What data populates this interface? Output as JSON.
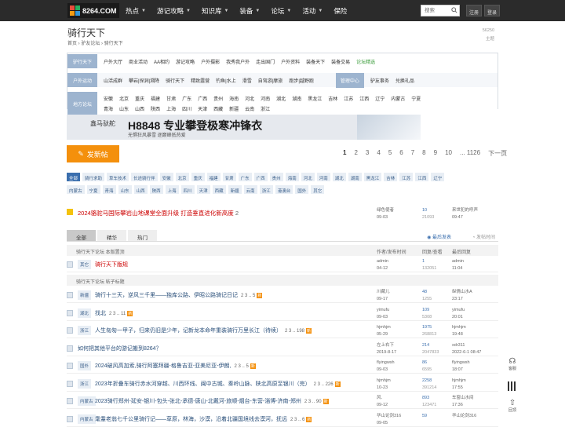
{
  "site": {
    "logo_text": "8264.COM",
    "nav": [
      {
        "label": "热点",
        "dropdown": true
      },
      {
        "label": "游记攻略",
        "dropdown": true
      },
      {
        "label": "知识库",
        "dropdown": true
      },
      {
        "label": "装备",
        "dropdown": true
      },
      {
        "label": "论坛",
        "dropdown": true
      },
      {
        "label": "活动",
        "dropdown": true
      },
      {
        "label": "保险",
        "dropdown": false
      }
    ],
    "search_placeholder": "搜索",
    "register": "注册",
    "login": "登录"
  },
  "forum": {
    "title": "骑行天下",
    "breadcrumb": "首页 › 驴友论坛 › 骑行天下",
    "stat_num": "56250",
    "stat_label": "主题"
  },
  "categories": [
    {
      "label": "驴行天下",
      "items": [
        "户外大厅",
        "商业活动",
        "AA相约",
        "游记攻略",
        "户外摄影",
        "我秀我户外",
        "走出国门",
        "户外资料",
        "装备天下",
        "装备交易",
        "论坛精选"
      ]
    },
    {
      "label": "户外运动",
      "items": [
        "山活成群",
        "攀岩|探洞|溯降",
        "骑行天下",
        "精致露营",
        "钓鱼|水上",
        "滑雪",
        "自驾游|摩旅",
        "跑步|越野跑"
      ],
      "extra": [
        "驴友事务",
        "兑换礼品"
      ],
      "selected": "管理中心"
    },
    {
      "label": "地方论坛",
      "items": [
        "安徽",
        "北京",
        "重庆",
        "福建",
        "甘肃",
        "广东",
        "广西",
        "贵州",
        "海南",
        "河北",
        "河南",
        "湖北",
        "湖南",
        "黑龙江",
        "吉林",
        "江苏",
        "江西",
        "辽宁",
        "内蒙古",
        "宁夏"
      ],
      "items2": [
        "青海",
        "山东",
        "山西",
        "陕西",
        "上海",
        "四川",
        "天津",
        "西藏",
        "新疆",
        "云南",
        "浙江"
      ]
    }
  ],
  "banner": {
    "brand": "鑫马驮舵",
    "title": "H8848 专业攀登极寒冲锋衣",
    "sub": "无惧狂风暴雪  逐巅峰抵热爱"
  },
  "post_button": "发新帖",
  "pager": [
    "1",
    "2",
    "3",
    "4",
    "5",
    "6",
    "7",
    "8",
    "9",
    "10",
    "... 1126",
    "下一页"
  ],
  "tags_row1": [
    "全部",
    "骑行求助",
    "草车技术",
    "长途骑行伴",
    "安徽",
    "北京",
    "重庆",
    "福建",
    "甘肃",
    "广东",
    "广西",
    "贵州",
    "海南",
    "河北",
    "河南",
    "湖北",
    "湖南",
    "黑龙江",
    "吉林",
    "江苏",
    "江西",
    "辽宁"
  ],
  "tags_row2": [
    "内蒙古",
    "宁夏",
    "青海",
    "山东",
    "山西",
    "陕西",
    "上海",
    "四川",
    "天津",
    "西藏",
    "新疆",
    "云南",
    "浙江",
    "港澳台",
    "国外",
    "其它"
  ],
  "announcement": {
    "title": "2024骆驼马国际攀岩山地课堂全面升级 打造垂直进化新高度",
    "count": "2",
    "author": "绿色使者",
    "date": "09-03",
    "replies": "10",
    "views": "21093",
    "last": "来世犯的呼声",
    "last_time": "09:47"
  },
  "tabs": [
    "全部",
    "精华",
    "热门"
  ],
  "sort_new": "最后发表",
  "sort_time": "发帖时间",
  "header": {
    "col1": "骑行天下论坛 本版置顶",
    "col2": "作者/发布时间",
    "col3": "回复/查看",
    "col4": "最后回复"
  },
  "pinned": [
    {
      "tag": "其它",
      "title": "骑行天下版规",
      "author": "admin",
      "date": "04-12",
      "replies": "1",
      "views": "132051",
      "last": "admin",
      "last_time": "11:04"
    }
  ],
  "section2": "骑行天下论坛 帖子标题",
  "rows": [
    {
      "tag": "新疆",
      "title": "骑行十三天，逆风三千里——独库公路、伊昭公路骑记日记",
      "pages": "2 3 .. 5",
      "new": true,
      "author": "川藏儿",
      "date": "09-17",
      "replies": "48",
      "views": "1255",
      "last": "纵情山水A",
      "last_time": "23:17"
    },
    {
      "tag": "湖北",
      "title": "找北",
      "pages": "2 3 .. 11",
      "new": true,
      "author": "yimufu",
      "date": "09-03",
      "replies": "109",
      "views": "5308",
      "last": "yimufu",
      "last_time": "20:01"
    },
    {
      "tag": "浙江",
      "title": "人生匆匆一甲子，归来仍旧是少年，记新龙本命年重装骑行万里长江（待续）",
      "pages": "2 3 .. 198",
      "new": true,
      "author": "hjmhjm",
      "date": "05-29",
      "replies": "1975",
      "views": "268813",
      "last": "hjmhjm",
      "last_time": "19:48"
    },
    {
      "tag": "",
      "title": "如何把其他平台的游记搬到8264？",
      "pages": "",
      "new": false,
      "author": "左上右下",
      "date": "2019-8-17",
      "replies": "214",
      "views": "2047833",
      "last": "xdr311",
      "last_time": "2022-6-1 08:47"
    },
    {
      "tag": "国外",
      "title": "2024破风高加索,骑行阿塞拜疆-格鲁吉亚-亚美尼亚-伊朗,",
      "pages": "2 3 .. 5",
      "new": true,
      "author": "flyingwsh",
      "date": "09-03",
      "replies": "86",
      "views": "6595",
      "last": "flyingwsh",
      "last_time": "18:07"
    },
    {
      "tag": "浙江",
      "title": "2023年折叠车骑行赤水河穿越、川西环线、闽中古城、秦岭山脉、陕北高原至银川（完）",
      "pages": "2 3 .. 226",
      "new": true,
      "author": "hjmhjm",
      "date": "10-23",
      "replies": "2258",
      "views": "391214",
      "last": "hjmhjm",
      "last_time": "17:55"
    },
    {
      "tag": "内蒙古",
      "title": "2023骑行郑州-延安-银川-包头-张北-承德-唐山-北戴河-旅顺-烟台-东营-淄博-济南-郑州",
      "pages": "2 3 .. 90",
      "new": true,
      "author": "风.",
      "date": "09-12",
      "replies": "893",
      "views": "123471",
      "last": "车窗山水间",
      "last_time": "17:36"
    },
    {
      "tag": "内蒙古",
      "title": "耄耋老翁七千公里骑行记——草原，林海，沙漠，沿着北疆国境线去漠河，抚远",
      "pages": "2 3 .. 6",
      "new": true,
      "author": "华山论剑316",
      "date": "09-05",
      "replies": "59",
      "views": "",
      "last": "华山论剑316",
      "last_time": ""
    }
  ],
  "side": [
    "客服",
    "",
    "回顶"
  ]
}
